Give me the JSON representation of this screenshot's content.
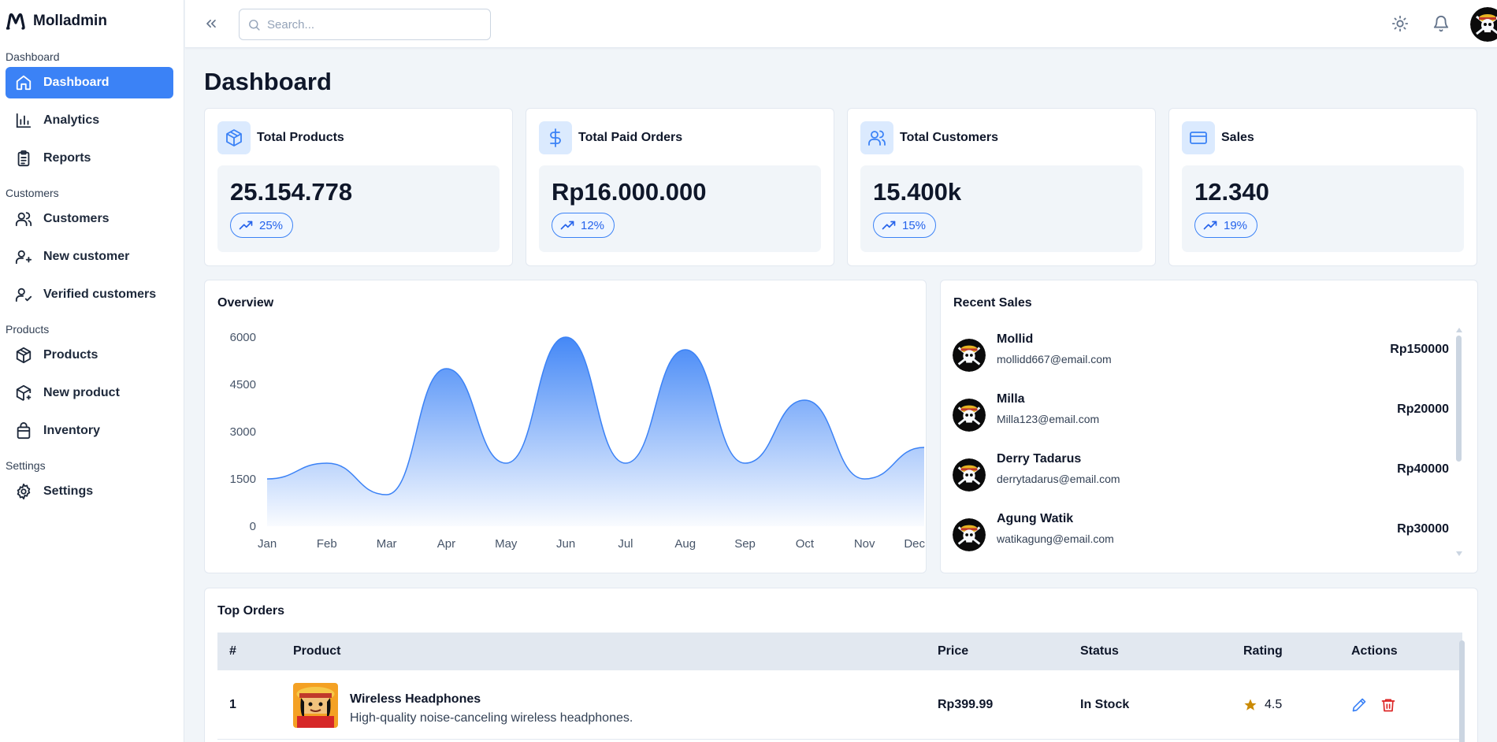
{
  "app": {
    "name": "Molladmin"
  },
  "sidebar": {
    "sections": [
      {
        "title": "Dashboard",
        "items": [
          {
            "label": "Dashboard",
            "icon": "home-icon",
            "active": true
          },
          {
            "label": "Analytics",
            "icon": "bar-chart-icon"
          },
          {
            "label": "Reports",
            "icon": "clipboard-icon"
          }
        ]
      },
      {
        "title": "Customers",
        "items": [
          {
            "label": "Customers",
            "icon": "users-icon"
          },
          {
            "label": "New customer",
            "icon": "user-plus-icon"
          },
          {
            "label": "Verified customers",
            "icon": "user-check-icon"
          }
        ]
      },
      {
        "title": "Products",
        "items": [
          {
            "label": "Products",
            "icon": "box-icon"
          },
          {
            "label": "New product",
            "icon": "box-plus-icon"
          },
          {
            "label": "Inventory",
            "icon": "shopping-bag-icon"
          }
        ]
      },
      {
        "title": "Settings",
        "items": [
          {
            "label": "Settings",
            "icon": "gear-icon"
          }
        ]
      }
    ]
  },
  "topbar": {
    "search_placeholder": "Search..."
  },
  "page": {
    "title": "Dashboard"
  },
  "stats": [
    {
      "title": "Total Products",
      "value": "25.154.778",
      "change": "25%",
      "icon": "box-icon"
    },
    {
      "title": "Total Paid Orders",
      "value": "Rp16.000.000",
      "change": "12%",
      "icon": "dollar-icon"
    },
    {
      "title": "Total Customers",
      "value": "15.400k",
      "change": "15%",
      "icon": "users-icon"
    },
    {
      "title": "Sales",
      "value": "12.340",
      "change": "19%",
      "icon": "credit-card-icon"
    }
  ],
  "overview": {
    "title": "Overview"
  },
  "chart_data": {
    "type": "area",
    "title": "Overview",
    "categories": [
      "Jan",
      "Feb",
      "Mar",
      "Apr",
      "May",
      "Jun",
      "Jul",
      "Aug",
      "Sep",
      "Oct",
      "Nov",
      "Dec"
    ],
    "values": [
      1500,
      2000,
      1000,
      5000,
      2000,
      6000,
      2000,
      5600,
      2000,
      4000,
      1500,
      2500
    ],
    "yticks": [
      0,
      1500,
      3000,
      4500,
      6000
    ],
    "ylim": [
      0,
      6000
    ],
    "grid": false,
    "color": "#3b82f6"
  },
  "recent_sales": {
    "title": "Recent Sales",
    "items": [
      {
        "name": "Mollid",
        "email": "mollidd667@email.com",
        "amount": "Rp150000"
      },
      {
        "name": "Milla",
        "email": "Milla123@email.com",
        "amount": "Rp20000"
      },
      {
        "name": "Derry Tadarus",
        "email": "derrytadarus@email.com",
        "amount": "Rp40000"
      },
      {
        "name": "Agung Watik",
        "email": "watikagung@email.com",
        "amount": "Rp30000"
      }
    ]
  },
  "top_orders": {
    "title": "Top Orders",
    "columns": [
      "#",
      "Product",
      "Price",
      "Status",
      "Rating",
      "Actions"
    ],
    "rows": [
      {
        "no": "1",
        "name": "Wireless Headphones",
        "desc": "High-quality noise-canceling wireless headphones.",
        "price": "Rp399.99",
        "status": "In Stock",
        "rating": "4.5"
      }
    ]
  },
  "colors": {
    "accent": "#3b82f6",
    "danger": "#dc2626",
    "star": "#ca8a04"
  }
}
